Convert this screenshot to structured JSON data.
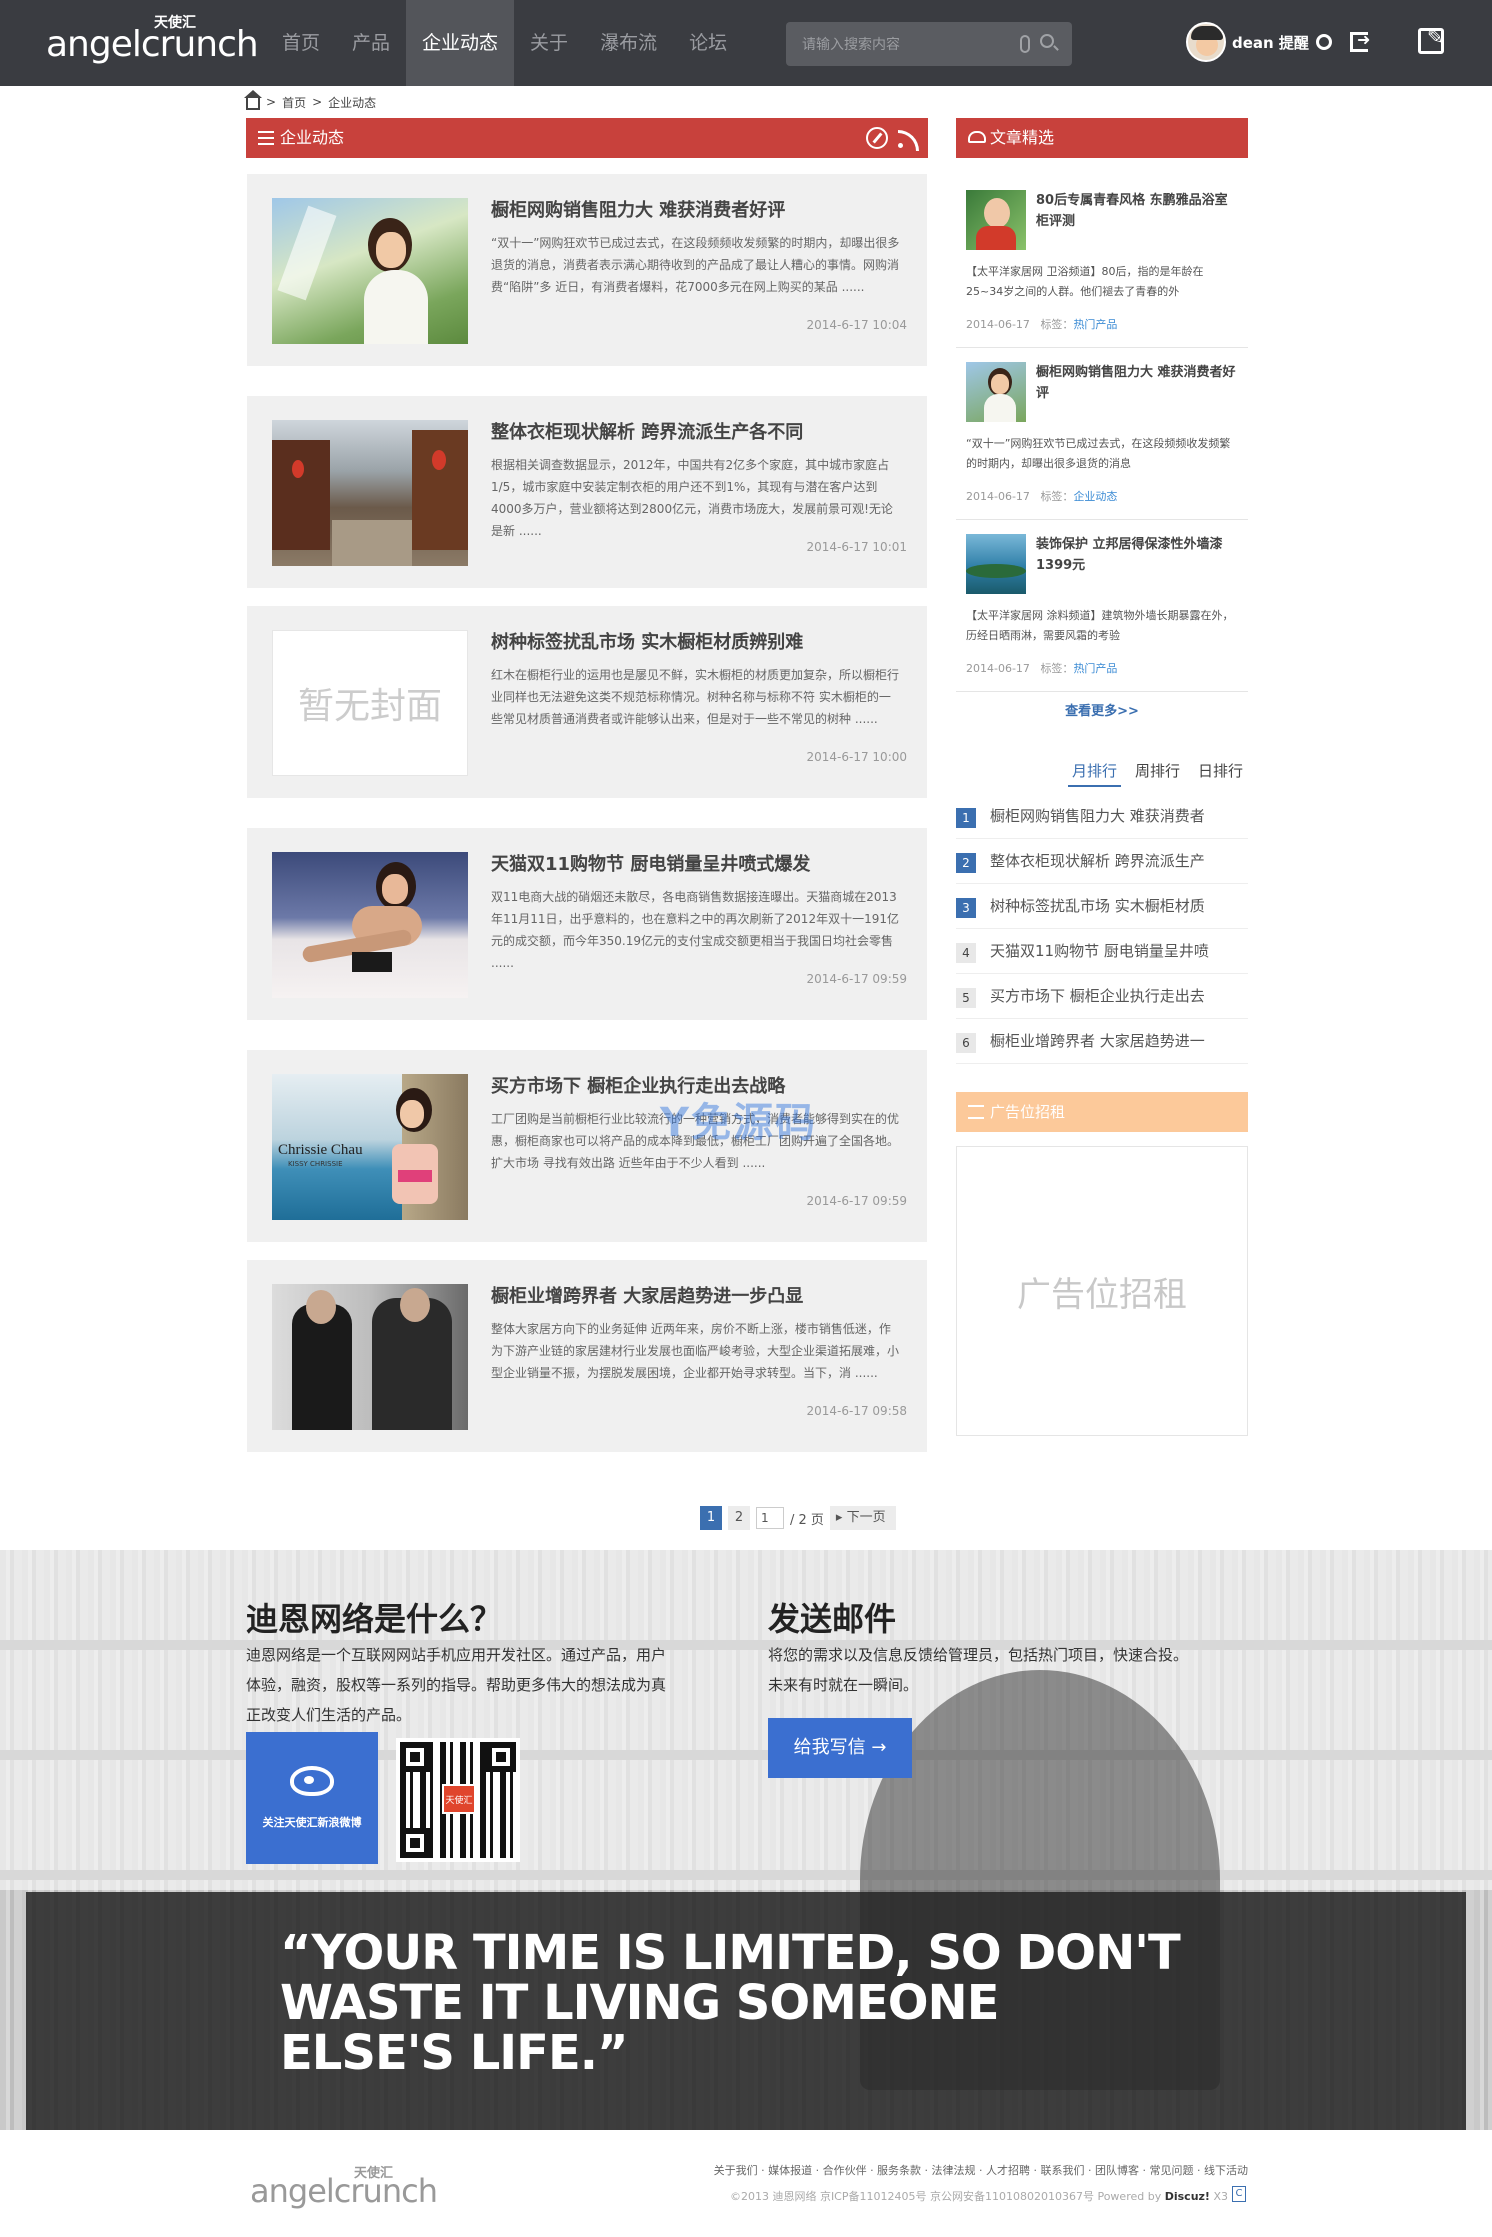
{
  "header": {
    "logo_small": "天使汇",
    "logo": "angelcrunch",
    "nav": [
      {
        "label": "首页"
      },
      {
        "label": "产品"
      },
      {
        "label": "企业动态"
      },
      {
        "label": "关于"
      },
      {
        "label": "瀑布流"
      },
      {
        "label": "论坛"
      }
    ],
    "search_placeholder": "请输入搜索内容",
    "username": "dean 提醒"
  },
  "breadcrumb": {
    "home": "首页",
    "sep": ">",
    "current": "企业动态"
  },
  "section_title": "企业动态",
  "posts": [
    {
      "title": "橱柜网购销售阻力大 难获消费者好评",
      "excerpt": "“双十一”网购狂欢节已成过去式，在这段频频收发频繁的时期内，却曝出很多退货的消息，消费者表示满心期待收到的产品成了最让人糟心的事情。网购消费“陷阱”多  近日，有消费者爆料，花7000多元在网上购买的某品 ......",
      "date": "2014-6-17 10:04",
      "thumb": "woman"
    },
    {
      "title": "整体衣柜现状解析 跨界流派生产各不同",
      "excerpt": "根据相关调查数据显示，2012年，中国共有2亿多个家庭，其中城市家庭占1/5，城市家庭中安装定制衣柜的用户还不到1%，其现有与潜在客户达到4000多万户，营业额将达到2800亿元，消费市场庞大，发展前景可观!无论是新 ......",
      "date": "2014-6-17 10:01",
      "thumb": "street"
    },
    {
      "title": "树种标签扰乱市场 实木橱柜材质辨别难",
      "excerpt": "红木在橱柜行业的运用也是屡见不鲜，实木橱柜的材质更加复杂，所以橱柜行业同样也无法避免这类不规范标称情况。树种名称与标称不符  实木橱柜的一些常见材质普通消费者或许能够认出来，但是对于一些不常见的树种 ......",
      "date": "2014-6-17 10:00",
      "thumb": "none",
      "no_cover": "暂无封面"
    },
    {
      "title": "天猫双11购物节 厨电销量呈井喷式爆发",
      "excerpt": "双11电商大战的硝烟还未散尽，各电商销售数据接连曝出。天猫商城在2013年11月11日，出乎意料的，也在意料之中的再次刷新了2012年双十一191亿元的成交额，而今年350.19亿元的支付宝成交额更相当于我国日均社会零售 ......",
      "date": "2014-6-17 09:59",
      "thumb": "model"
    },
    {
      "title": "买方市场下 橱柜企业执行走出去战略",
      "excerpt": "工厂团购是当前橱柜行业比较流行的一种营销方式，消费者能够得到实在的优惠，橱柜商家也可以将产品的成本降到最低，橱柜工厂团购开遍了全国各地。扩大市场 寻找有效出路  近些年由于不少人看到 ......",
      "date": "2014-6-17 09:59",
      "thumb": "beach",
      "thumb_text": "Chrissie Chau",
      "thumb_sub": "KISSY CHRISSIE"
    },
    {
      "title": "橱柜业增跨界者 大家居趋势进一步凸显",
      "excerpt": "整体大家居方向下的业务延伸  近两年来，房价不断上涨，楼市销售低迷，作为下游产业链的家居建材行业发展也面临严峻考验，大型企业渠道拓展难，小型企业销量不振，为摆脱发展困境，企业都开始寻求转型。当下，消 ......",
      "date": "2014-6-17 09:58",
      "thumb": "suits"
    }
  ],
  "sidebar": {
    "featured_title": "文章精选",
    "featured": [
      {
        "title": "80后专属青春风格 东鹏雅品浴室柜评测",
        "excerpt": "【太平洋家居网 卫浴频道】80后，指的是年龄在25~34岁之间的人群。他们褪去了青春的外",
        "date": "2014-06-17",
        "tag_label": "标签：",
        "tag": "热门产品",
        "thumb": "green"
      },
      {
        "title": "橱柜网购销售阻力大 难获消费者好评",
        "excerpt": "“双十一”网购狂欢节已成过去式，在这段频频收发频繁的时期内，却曝出很多退货的消息",
        "date": "2014-06-17",
        "tag_label": "标签：",
        "tag": "企业动态",
        "thumb": "woman"
      },
      {
        "title": "装饰保护 立邦居得保漆性外墙漆1399元",
        "excerpt": "【太平洋家居网 涂料频道】建筑物外墙长期暴露在外，历经日晒雨淋，需要风霜的考验",
        "date": "2014-06-17",
        "tag_label": "标签：",
        "tag": "热门产品",
        "thumb": "sea"
      }
    ],
    "more": "查看更多>>",
    "tabs": [
      {
        "label": "月排行"
      },
      {
        "label": "周排行"
      },
      {
        "label": "日排行"
      }
    ],
    "ranking": [
      {
        "num": "1",
        "title": "橱柜网购销售阻力大 难获消费者"
      },
      {
        "num": "2",
        "title": "整体衣柜现状解析 跨界流派生产"
      },
      {
        "num": "3",
        "title": "树种标签扰乱市场 实木橱柜材质"
      },
      {
        "num": "4",
        "title": "天猫双11购物节 厨电销量呈井喷"
      },
      {
        "num": "5",
        "title": "买方市场下 橱柜企业执行走出去"
      },
      {
        "num": "6",
        "title": "橱柜业增跨界者 大家居趋势进一"
      }
    ],
    "ad_title": "广告位招租",
    "ad_text": "广告位招租"
  },
  "pager": {
    "p1": "1",
    "p2": "2",
    "input": "1",
    "total": "/ 2 页",
    "next": "下一页"
  },
  "footer": {
    "about_title": "迪恩网络是什么？",
    "about_text": "迪恩网络是一个互联网网站手机应用开发社区。通过产品，用户体验，融资，股权等一系列的指导。帮助更多伟大的想法成为真正改变人们生活的产品。",
    "weibo": "关注天使汇新浪微博",
    "qr_label": "天使汇",
    "mail_title": "发送邮件",
    "mail_text": "将您的需求以及信息反馈给管理员，包括热门项目，快速合投。未来有时就在一瞬间。",
    "mail_button": "给我写信 →",
    "quote": "“YOUR TIME IS LIMITED, SO DON'T WASTE IT LIVING SOMEONE ELSE'S LIFE.”",
    "logo_small": "天使汇",
    "logo": "angelcrunch",
    "links": "关于我们 · 媒体报道 · 合作伙伴 · 服务条款 · 法律法规 · 人才招聘 · 联系我们 · 团队博客 · 常见问题 · 线下活动",
    "copyright": "©2013 迪恩网络  京ICP备11012405号  京公网安备11010802010367号  Powered by",
    "powered": "Discuz!",
    "version": "X3"
  },
  "watermark": "Y免源码",
  "colors": {
    "topbar": "#3a3c41",
    "accent_red": "#c8413c",
    "accent_blue": "#3b6fd0",
    "ad_orange": "#fcc99a"
  }
}
